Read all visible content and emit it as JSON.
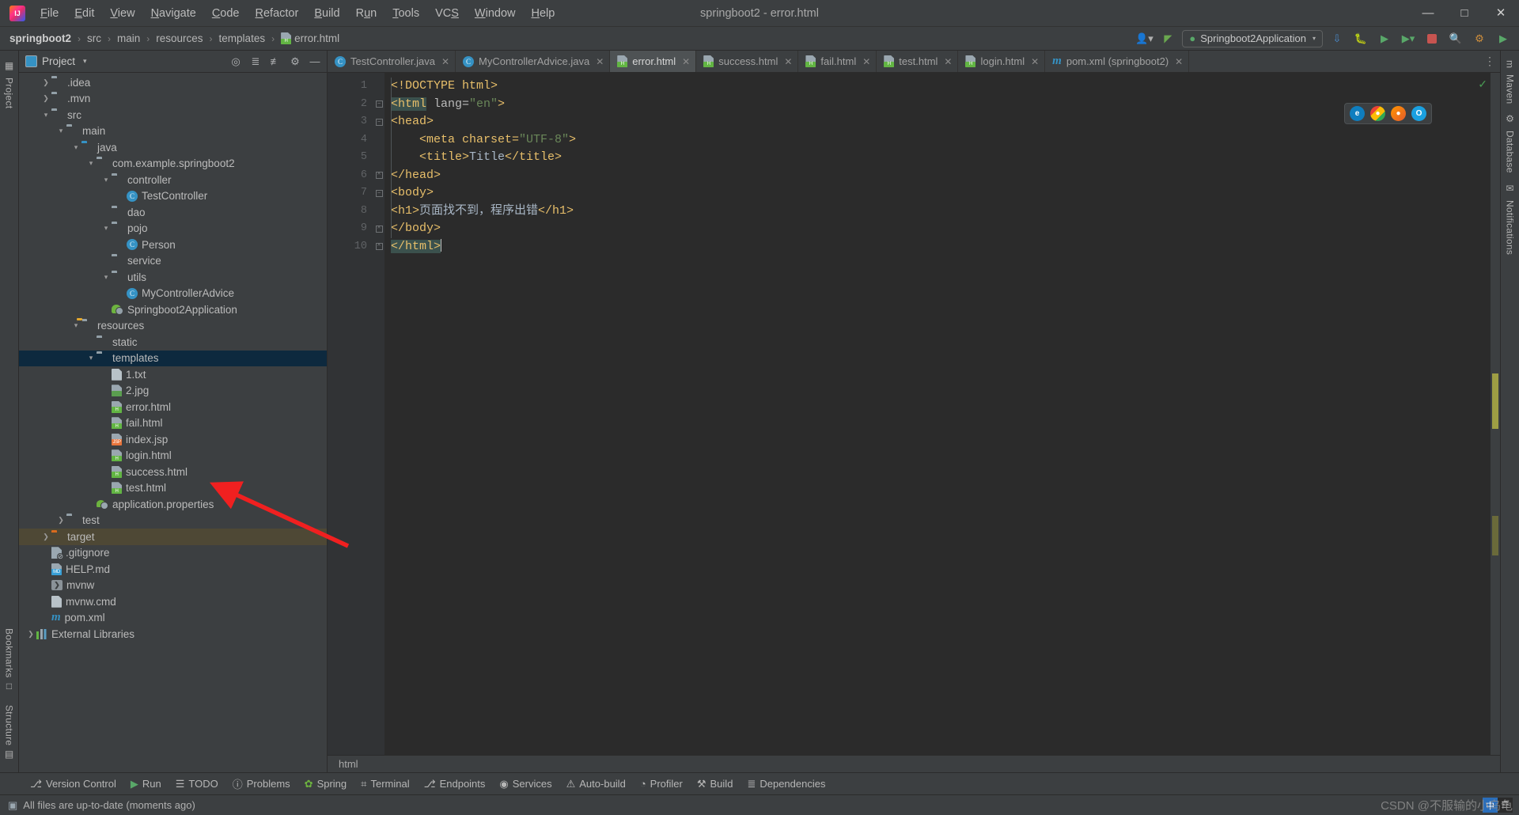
{
  "window": {
    "title": "springboot2 - error.html",
    "app_icon": "intellij-idea-logo",
    "minimize": "—",
    "maximize": "□",
    "close": "✕"
  },
  "menubar": [
    {
      "label": "File",
      "mnemonic": "F"
    },
    {
      "label": "Edit",
      "mnemonic": "E"
    },
    {
      "label": "View",
      "mnemonic": "V"
    },
    {
      "label": "Navigate",
      "mnemonic": "N"
    },
    {
      "label": "Code",
      "mnemonic": "C"
    },
    {
      "label": "Refactor",
      "mnemonic": "R"
    },
    {
      "label": "Build",
      "mnemonic": "B"
    },
    {
      "label": "Run",
      "mnemonic": "u"
    },
    {
      "label": "Tools",
      "mnemonic": "T"
    },
    {
      "label": "VCS",
      "mnemonic": "S"
    },
    {
      "label": "Window",
      "mnemonic": "W"
    },
    {
      "label": "Help",
      "mnemonic": "H"
    }
  ],
  "breadcrumb": {
    "separator": "›",
    "items": [
      {
        "label": "springboot2",
        "icon": "none",
        "root": true
      },
      {
        "label": "src",
        "icon": "none"
      },
      {
        "label": "main",
        "icon": "none"
      },
      {
        "label": "resources",
        "icon": "none"
      },
      {
        "label": "templates",
        "icon": "none"
      },
      {
        "label": "error.html",
        "icon": "html-file-icon"
      }
    ]
  },
  "toolbar": {
    "user_icon": "user-dropdown-icon",
    "hammer_icon": "build-hammer-icon",
    "run_config": "Springboot2Application",
    "run_config_caret": "▾",
    "update_icon": "update-project-icon",
    "debug_icon": "debug-icon",
    "run_icon": "run-icon",
    "coverage_icon": "run-with-coverage-icon",
    "stop_icon": "stop-icon",
    "search_icon": "search-everywhere-icon",
    "settings_icon": "settings-gear-icon",
    "plugin_icon": "plugin-icon"
  },
  "left_rail": {
    "top": [
      {
        "label": "Project",
        "icon": "project-icon"
      }
    ],
    "bottom": [
      {
        "label": "Bookmarks",
        "icon": "bookmarks-icon"
      },
      {
        "label": "Structure",
        "icon": "structure-icon"
      }
    ]
  },
  "right_rail": {
    "items": [
      {
        "label": "Maven",
        "icon": "maven-icon"
      },
      {
        "label": "Database",
        "icon": "database-icon"
      },
      {
        "label": "Notifications",
        "icon": "notifications-icon"
      }
    ]
  },
  "project_panel": {
    "title": "Project",
    "caret": "▾",
    "icons": [
      "locate-icon",
      "expand-all-icon",
      "collapse-all-icon",
      "gear-icon",
      "hide-icon"
    ],
    "tree": [
      {
        "label": ".idea",
        "icon": "folder-icon",
        "indent": 1,
        "arrow": "collapsed"
      },
      {
        "label": ".mvn",
        "icon": "folder-icon",
        "indent": 1,
        "arrow": "collapsed"
      },
      {
        "label": "src",
        "icon": "folder-icon",
        "indent": 1,
        "arrow": "expanded"
      },
      {
        "label": "main",
        "icon": "folder-icon",
        "indent": 2,
        "arrow": "expanded"
      },
      {
        "label": "java",
        "icon": "java-source-folder-icon",
        "indent": 3,
        "arrow": "expanded"
      },
      {
        "label": "com.example.springboot2",
        "icon": "package-icon",
        "indent": 4,
        "arrow": "expanded"
      },
      {
        "label": "controller",
        "icon": "package-icon",
        "indent": 5,
        "arrow": "expanded"
      },
      {
        "label": "TestController",
        "icon": "java-class-icon",
        "indent": 6,
        "arrow": "none"
      },
      {
        "label": "dao",
        "icon": "package-icon",
        "indent": 5,
        "arrow": "none"
      },
      {
        "label": "pojo",
        "icon": "package-icon",
        "indent": 5,
        "arrow": "expanded"
      },
      {
        "label": "Person",
        "icon": "java-class-icon",
        "indent": 6,
        "arrow": "none"
      },
      {
        "label": "service",
        "icon": "package-icon",
        "indent": 5,
        "arrow": "none"
      },
      {
        "label": "utils",
        "icon": "package-icon",
        "indent": 5,
        "arrow": "expanded"
      },
      {
        "label": "MyControllerAdvice",
        "icon": "java-class-icon",
        "indent": 6,
        "arrow": "none"
      },
      {
        "label": "Springboot2Application",
        "icon": "spring-boot-class-icon",
        "indent": 5,
        "arrow": "none"
      },
      {
        "label": "resources",
        "icon": "resources-folder-icon",
        "indent": 3,
        "arrow": "expanded"
      },
      {
        "label": "static",
        "icon": "folder-icon",
        "indent": 4,
        "arrow": "none"
      },
      {
        "label": "templates",
        "icon": "folder-icon",
        "indent": 4,
        "arrow": "expanded",
        "selected": true
      },
      {
        "label": "1.txt",
        "icon": "text-file-icon",
        "indent": 5,
        "arrow": "none"
      },
      {
        "label": "2.jpg",
        "icon": "image-file-icon",
        "indent": 5,
        "arrow": "none"
      },
      {
        "label": "error.html",
        "icon": "html-file-icon",
        "indent": 5,
        "arrow": "none"
      },
      {
        "label": "fail.html",
        "icon": "html-file-icon",
        "indent": 5,
        "arrow": "none"
      },
      {
        "label": "index.jsp",
        "icon": "jsp-file-icon",
        "indent": 5,
        "arrow": "none"
      },
      {
        "label": "login.html",
        "icon": "html-file-icon",
        "indent": 5,
        "arrow": "none"
      },
      {
        "label": "success.html",
        "icon": "html-file-icon",
        "indent": 5,
        "arrow": "none"
      },
      {
        "label": "test.html",
        "icon": "html-file-icon",
        "indent": 5,
        "arrow": "none"
      },
      {
        "label": "application.properties",
        "icon": "spring-properties-icon",
        "indent": 4,
        "arrow": "none"
      },
      {
        "label": "test",
        "icon": "folder-icon",
        "indent": 2,
        "arrow": "collapsed"
      },
      {
        "label": "target",
        "icon": "target-folder-icon",
        "indent": 1,
        "arrow": "collapsed",
        "dim_selected": true
      },
      {
        "label": ".gitignore",
        "icon": "gitignore-file-icon",
        "indent": 1,
        "arrow": "none"
      },
      {
        "label": "HELP.md",
        "icon": "markdown-file-icon",
        "indent": 1,
        "arrow": "none"
      },
      {
        "label": "mvnw",
        "icon": "shell-script-icon",
        "indent": 1,
        "arrow": "none"
      },
      {
        "label": "mvnw.cmd",
        "icon": "text-file-icon",
        "indent": 1,
        "arrow": "none"
      },
      {
        "label": "pom.xml",
        "icon": "maven-pom-icon",
        "indent": 1,
        "arrow": "none"
      },
      {
        "label": "External Libraries",
        "icon": "libraries-icon",
        "indent": 0,
        "arrow": "collapsed"
      }
    ]
  },
  "editor": {
    "tabs": [
      {
        "label": "TestController.java",
        "icon": "java-class-icon",
        "active": false
      },
      {
        "label": "MyControllerAdvice.java",
        "icon": "java-class-icon",
        "active": false
      },
      {
        "label": "error.html",
        "icon": "html-file-icon",
        "active": true
      },
      {
        "label": "success.html",
        "icon": "html-file-icon",
        "active": false
      },
      {
        "label": "fail.html",
        "icon": "html-file-icon",
        "active": false
      },
      {
        "label": "test.html",
        "icon": "html-file-icon",
        "active": false
      },
      {
        "label": "login.html",
        "icon": "html-file-icon",
        "active": false
      },
      {
        "label": "pom.xml (springboot2)",
        "icon": "maven-pom-icon",
        "active": false
      }
    ],
    "tab_close": "✕",
    "tab_overflow": "⋮",
    "line_numbers": [
      "1",
      "2",
      "3",
      "4",
      "5",
      "6",
      "7",
      "8",
      "9",
      "10"
    ],
    "lines": [
      {
        "n": 1,
        "fold": "",
        "tokens": [
          {
            "t": "<!DOCTYPE html>",
            "c": "tok-doctype"
          }
        ]
      },
      {
        "n": 2,
        "fold": "minus",
        "tokens": [
          {
            "t": "<html",
            "c": "tok-tag",
            "hl": true
          },
          {
            "t": " lang=",
            "c": "tok-attr"
          },
          {
            "t": "\"en\"",
            "c": "tok-str"
          },
          {
            "t": ">",
            "c": "tok-tag"
          }
        ]
      },
      {
        "n": 3,
        "fold": "minus",
        "tokens": [
          {
            "t": "<head>",
            "c": "tok-tag"
          }
        ]
      },
      {
        "n": 4,
        "fold": "",
        "tokens": [
          {
            "t": "    <meta charset=",
            "c": "tok-tag"
          },
          {
            "t": "\"UTF-8\"",
            "c": "tok-str"
          },
          {
            "t": ">",
            "c": "tok-tag"
          }
        ]
      },
      {
        "n": 5,
        "fold": "",
        "tokens": [
          {
            "t": "    <title>",
            "c": "tok-tag"
          },
          {
            "t": "Title",
            "c": "tok-text"
          },
          {
            "t": "</title>",
            "c": "tok-tag"
          }
        ]
      },
      {
        "n": 6,
        "fold": "end",
        "tokens": [
          {
            "t": "</head>",
            "c": "tok-tag"
          }
        ]
      },
      {
        "n": 7,
        "fold": "minus",
        "tokens": [
          {
            "t": "<body>",
            "c": "tok-tag"
          }
        ]
      },
      {
        "n": 8,
        "fold": "",
        "tokens": [
          {
            "t": "<h1>",
            "c": "tok-tag"
          },
          {
            "t": "页面找不到，程序出错",
            "c": "tok-text"
          },
          {
            "t": "</h1>",
            "c": "tok-tag"
          }
        ]
      },
      {
        "n": 9,
        "fold": "end",
        "tokens": [
          {
            "t": "</body>",
            "c": "tok-tag"
          }
        ]
      },
      {
        "n": 10,
        "fold": "end",
        "tokens": [
          {
            "t": "</html>",
            "c": "tok-tag",
            "hl": true,
            "caret": true
          }
        ]
      }
    ],
    "inspection_status": "✓",
    "breadcrumb_bottom": "html",
    "float_icons": [
      "edge-browser-icon",
      "chrome-browser-icon",
      "firefox-browser-icon",
      "opera-browser-icon"
    ]
  },
  "tool_windows": [
    {
      "label": "Version Control",
      "icon": "version-control-icon"
    },
    {
      "label": "Run",
      "icon": "run-icon"
    },
    {
      "label": "TODO",
      "icon": "todo-icon"
    },
    {
      "label": "Problems",
      "icon": "problems-icon"
    },
    {
      "label": "Spring",
      "icon": "spring-icon"
    },
    {
      "label": "Terminal",
      "icon": "terminal-icon"
    },
    {
      "label": "Endpoints",
      "icon": "endpoints-icon"
    },
    {
      "label": "Services",
      "icon": "services-icon"
    },
    {
      "label": "Auto-build",
      "icon": "auto-build-icon"
    },
    {
      "label": "Profiler",
      "icon": "profiler-icon"
    },
    {
      "label": "Build",
      "icon": "build-icon"
    },
    {
      "label": "Dependencies",
      "icon": "dependencies-icon"
    }
  ],
  "statusbar": {
    "message": "All files are up-to-date (moments ago)",
    "message_icon": "vcs-status-icon",
    "ime_primary": "中",
    "ime_secondary": "☲",
    "watermark": "CSDN @不服输的小乌龟"
  },
  "colors": {
    "accent_blue": "#3592c4",
    "selection": "#0d293e",
    "spring_green": "#6db33f",
    "html_tag": "#e8bf6a",
    "string_green": "#6a8759",
    "annotation_red": "#f02020",
    "target_orange": "#d96b1e"
  }
}
